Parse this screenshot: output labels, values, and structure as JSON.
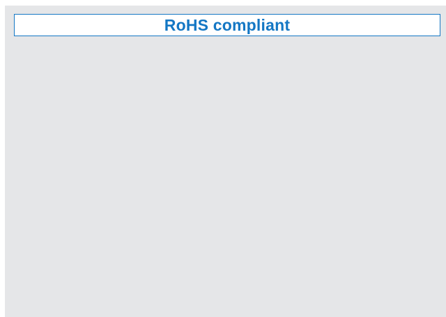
{
  "banner": {
    "title": "RoHS compliant"
  },
  "colors": {
    "accent": "#1477c4",
    "panel_background": "#e5e6e8",
    "banner_background": "#ffffff"
  }
}
